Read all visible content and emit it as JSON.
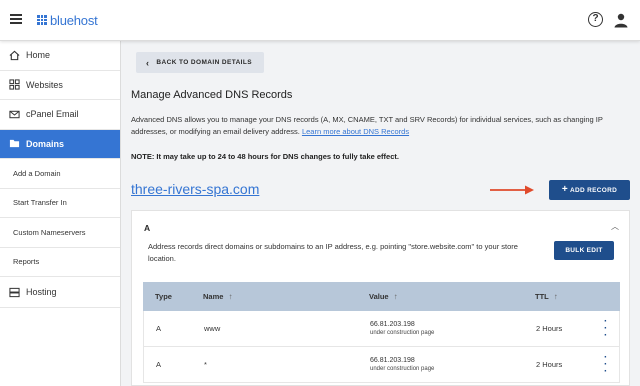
{
  "header": {
    "brand": "bluehost",
    "help_glyph": "?"
  },
  "sidebar": {
    "items": [
      {
        "label": "Home",
        "icon": "home-icon"
      },
      {
        "label": "Websites",
        "icon": "grid-icon"
      },
      {
        "label": "cPanel Email",
        "icon": "mail-icon"
      },
      {
        "label": "Domains",
        "icon": "folder-icon",
        "active": true
      },
      {
        "label": "Add a Domain"
      },
      {
        "label": "Start Transfer In"
      },
      {
        "label": "Custom Nameservers"
      },
      {
        "label": "Reports"
      },
      {
        "label": "Hosting",
        "icon": "server-icon"
      }
    ]
  },
  "main": {
    "back_label": "BACK TO DOMAIN DETAILS",
    "title": "Manage Advanced DNS Records",
    "description": "Advanced DNS allows you to manage your DNS records (A, MX, CNAME, TXT and SRV Records) for individual services, such as changing IP addresses, or modifying an email delivery address.",
    "learn_more": "Learn more about DNS Records",
    "note": "NOTE: It may take up to 24 to 48 hours for DNS changes to fully take effect.",
    "domain": "three-rivers-spa.com",
    "add_record_label": "ADD RECORD"
  },
  "card": {
    "title": "A",
    "description": "Address records direct domains or subdomains to an IP address, e.g. pointing \"store.website.com\" to your store location.",
    "bulk_edit_label": "BULK EDIT",
    "columns": {
      "type": "Type",
      "name": "Name",
      "value": "Value",
      "ttl": "TTL"
    },
    "rows": [
      {
        "type": "A",
        "name": "www",
        "value": "66.81.203.198",
        "value_note": "under construction page",
        "ttl": "2 Hours"
      },
      {
        "type": "A",
        "name": "*",
        "value": "66.81.203.198",
        "value_note": "under construction page",
        "ttl": "2 Hours"
      }
    ]
  },
  "colors": {
    "accent": "#3575d3",
    "button": "#1f4e8c",
    "arrow": "#e04a2b",
    "table_header": "#b7c7d9"
  }
}
